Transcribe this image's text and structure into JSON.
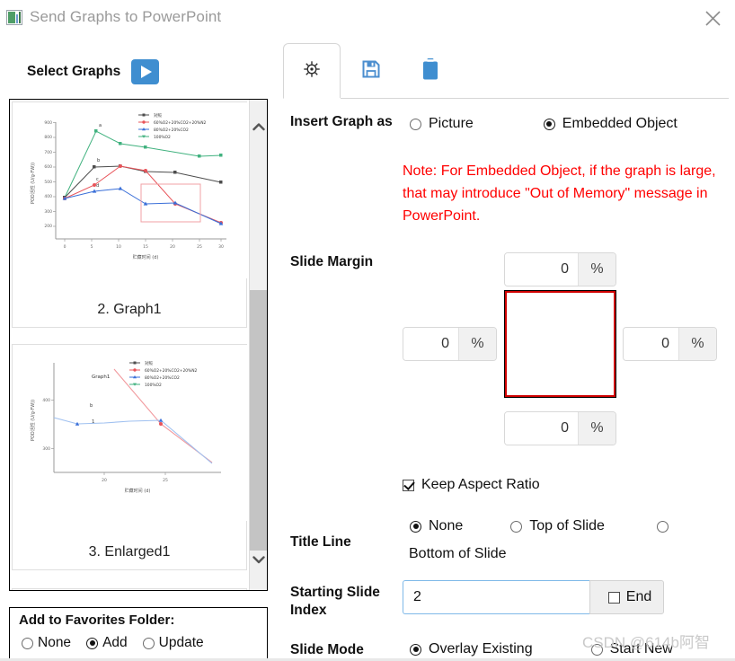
{
  "window": {
    "title": "Send Graphs to PowerPoint",
    "app_icon": "app-window-chart-icon",
    "close_icon": "close-icon"
  },
  "left_panel": {
    "select_graphs_label": "Select Graphs",
    "play_button_icon": "play-icon",
    "scroll_up_icon": "chevron-up-icon",
    "scroll_down_icon": "chevron-down-icon",
    "graphs": [
      {
        "caption": "2. Graph1"
      },
      {
        "caption": "3. Enlarged1"
      }
    ],
    "favorites": {
      "title": "Add to Favorites Folder:",
      "options": [
        {
          "label": "None",
          "selected": false
        },
        {
          "label": "Add",
          "selected": true
        },
        {
          "label": "Update",
          "selected": false
        }
      ]
    }
  },
  "tabs": [
    {
      "icon": "gear-icon",
      "active": true
    },
    {
      "icon": "save-floppy-icon",
      "active": false
    },
    {
      "icon": "clipboard-icon",
      "active": false
    }
  ],
  "form": {
    "insert_graph_as": {
      "label": "Insert Graph as",
      "options": [
        {
          "label": "Picture",
          "selected": false
        },
        {
          "label": "Embedded Object",
          "selected": true
        }
      ],
      "note": "Note: For Embedded Object, if the graph is large, that may introduce \"Out of Memory\" message in PowerPoint."
    },
    "slide_margin": {
      "label": "Slide Margin",
      "top": {
        "value": "0",
        "unit": "%"
      },
      "left": {
        "value": "0",
        "unit": "%"
      },
      "right": {
        "value": "0",
        "unit": "%"
      },
      "bottom": {
        "value": "0",
        "unit": "%"
      }
    },
    "keep_aspect_ratio": {
      "label": "Keep Aspect Ratio",
      "checked": true
    },
    "title_line": {
      "label": "Title Line",
      "options": [
        {
          "label": "None",
          "selected": true
        },
        {
          "label": "Top of Slide",
          "selected": false
        },
        {
          "label": "Bottom of Slide",
          "selected": false
        }
      ]
    },
    "starting_slide_index": {
      "label": "Starting Slide Index",
      "value": "2",
      "end_label": "End",
      "end_checked": false
    },
    "slide_mode": {
      "label": "Slide Mode",
      "options": [
        {
          "label": "Overlay Existing",
          "selected": true
        },
        {
          "label": "Start New",
          "selected": false
        }
      ]
    }
  },
  "watermark": "CSDN @614b阿智",
  "chart_data": [
    {
      "type": "line",
      "title": "",
      "xlabel": "贮藏时间 (d)",
      "ylabel": "POD活性 (U/g·FW))",
      "xlim": [
        -2,
        32
      ],
      "ylim": [
        200,
        900
      ],
      "xticks": [
        0,
        5,
        10,
        15,
        20,
        25,
        30
      ],
      "yticks": [
        200,
        300,
        400,
        500,
        600,
        700,
        800,
        900
      ],
      "grid": false,
      "legend_position": "top-right",
      "annotations": [
        "a",
        "b",
        "c",
        "d"
      ],
      "series": [
        {
          "name": "对照",
          "color": "#4d4d4d",
          "x": [
            0,
            6,
            12,
            18,
            24,
            30
          ],
          "values": [
            388,
            600,
            604,
            573,
            568,
            498
          ]
        },
        {
          "name": "60%O2+20%CO2+20%N2",
          "color": "#e8545a",
          "x": [
            0,
            6,
            12,
            18,
            24,
            30
          ],
          "values": [
            388,
            480,
            608,
            579,
            375,
            228
          ]
        },
        {
          "name": "80%O2+20%CO2",
          "color": "#3a6fd8",
          "x": [
            0,
            6,
            12,
            18,
            24,
            30
          ],
          "values": [
            385,
            424,
            440,
            372,
            378,
            222
          ]
        },
        {
          "name": "100%O2",
          "color": "#41b27f",
          "x": [
            0,
            6,
            12,
            18,
            24,
            30
          ],
          "values": [
            385,
            843,
            758,
            736,
            678,
            686
          ]
        }
      ]
    },
    {
      "type": "line",
      "title": "Graph1",
      "xlabel": "贮藏时间 (d)",
      "ylabel": "POD活性 (U/g·FW))",
      "xlim": [
        16,
        31
      ],
      "ylim": [
        250,
        460
      ],
      "xticks": [
        20,
        25
      ],
      "yticks": [
        300,
        400
      ],
      "grid": false,
      "legend_position": "top-right",
      "annotations": [
        "b",
        "1"
      ],
      "series": [
        {
          "name": "对照",
          "color": "#4d4d4d",
          "x": [],
          "values": []
        },
        {
          "name": "60%O2+20%CO2+20%N2",
          "color": "#e8545a",
          "x": [
            17,
            24,
            30
          ],
          "values": [
            470,
            372,
            258
          ]
        },
        {
          "name": "80%O2+20%CO2",
          "color": "#3a6fd8",
          "x": [
            17,
            18,
            21,
            24,
            30
          ],
          "values": [
            392,
            372,
            375,
            380,
            262
          ]
        },
        {
          "name": "100%O2",
          "color": "#41b27f",
          "x": [],
          "values": []
        }
      ]
    }
  ]
}
